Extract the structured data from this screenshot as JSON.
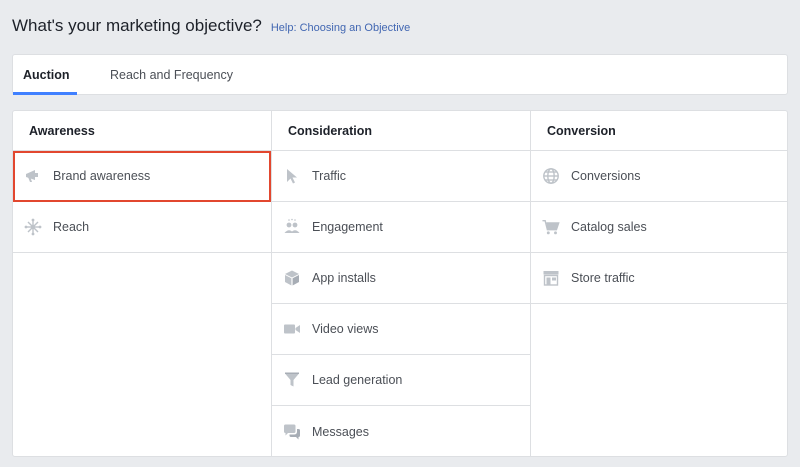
{
  "header": {
    "title": "What's your marketing objective?",
    "help_link": "Help: Choosing an Objective"
  },
  "tabs": [
    {
      "label": "Auction",
      "active": true
    },
    {
      "label": "Reach and Frequency",
      "active": false
    }
  ],
  "colors": {
    "accent": "#4080ff",
    "link": "#4267b2",
    "selected_outline": "#e2472f",
    "icon": "#bec3c9"
  },
  "columns": {
    "awareness": {
      "title": "Awareness",
      "items": [
        {
          "label": "Brand awareness",
          "icon": "megaphone-icon",
          "selected": true
        },
        {
          "label": "Reach",
          "icon": "reach-icon",
          "selected": false
        }
      ]
    },
    "consideration": {
      "title": "Consideration",
      "items": [
        {
          "label": "Traffic",
          "icon": "cursor-icon",
          "selected": false
        },
        {
          "label": "Engagement",
          "icon": "people-icon",
          "selected": false
        },
        {
          "label": "App installs",
          "icon": "box-icon",
          "selected": false
        },
        {
          "label": "Video views",
          "icon": "video-camera-icon",
          "selected": false
        },
        {
          "label": "Lead generation",
          "icon": "funnel-icon",
          "selected": false
        },
        {
          "label": "Messages",
          "icon": "chat-bubbles-icon",
          "selected": false
        }
      ]
    },
    "conversion": {
      "title": "Conversion",
      "items": [
        {
          "label": "Conversions",
          "icon": "globe-icon",
          "selected": false
        },
        {
          "label": "Catalog sales",
          "icon": "shopping-cart-icon",
          "selected": false
        },
        {
          "label": "Store traffic",
          "icon": "storefront-icon",
          "selected": false
        }
      ]
    }
  }
}
